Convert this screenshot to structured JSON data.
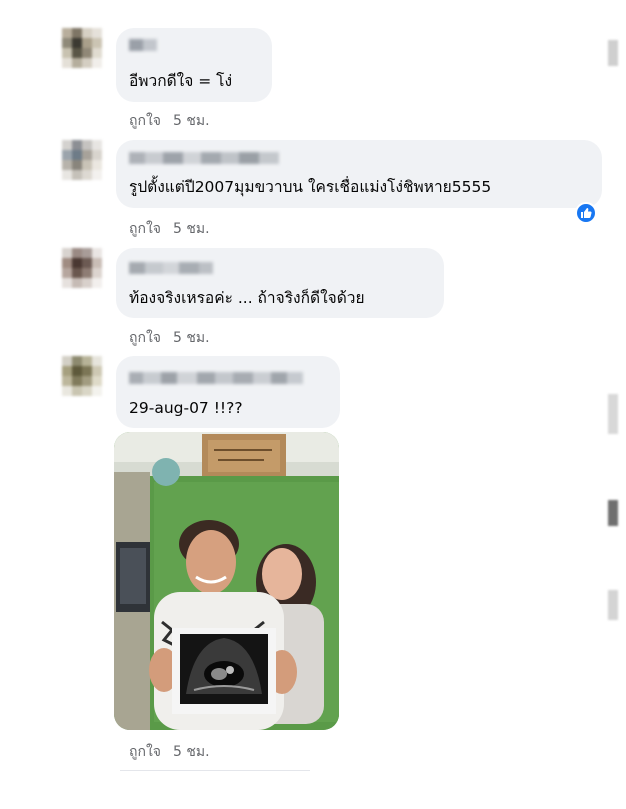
{
  "comments": [
    {
      "text": "อีพวกดีใจ = โง่",
      "like": "ถูกใจ",
      "time": "5 ชม."
    },
    {
      "text": "รูปตั้งแต่ปี2007มุมขวาบน ใครเชื่อแม่งโง่ชิพหาย5555",
      "like": "ถูกใจ",
      "time": "5 ชม.",
      "reaction": "like-icon"
    },
    {
      "text": "ท้องจริงเหรอค่ะ ... ถ้าจริงก็ดีใจด้วย",
      "like": "ถูกใจ",
      "time": "5 ชม."
    },
    {
      "text": "29-aug-07 !!??",
      "like": "ถูกใจ",
      "time": "5 ชม.",
      "attachment": "photo"
    }
  ],
  "colors": {
    "bubble": "#f0f2f5",
    "meta": "#65676b",
    "reaction": "#1877f2"
  }
}
